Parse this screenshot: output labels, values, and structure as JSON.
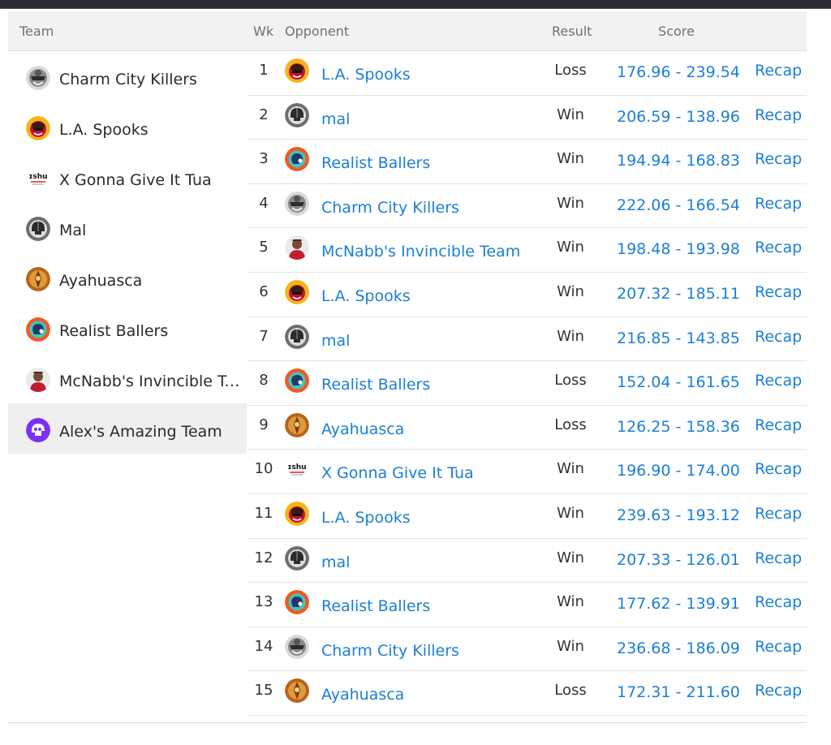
{
  "header": {
    "team": "Team",
    "wk": "Wk",
    "opponent": "Opponent",
    "result": "Result",
    "score": "Score"
  },
  "colors": {
    "link": "#1a7fd6",
    "header_bg": "#f2f2f2",
    "active_bg": "#efefef"
  },
  "teams": [
    {
      "name": "Charm City Killers",
      "icon": "charm-city-killers-logo-icon"
    },
    {
      "name": "L.A. Spooks",
      "icon": "la-spooks-logo-icon"
    },
    {
      "name": "X Gonna Give It Tua",
      "icon": "x-gonna-give-it-tua-logo-icon"
    },
    {
      "name": "Mal",
      "icon": "mal-logo-icon"
    },
    {
      "name": "Ayahuasca",
      "icon": "ayahuasca-logo-icon"
    },
    {
      "name": "Realist Ballers",
      "icon": "realist-ballers-logo-icon"
    },
    {
      "name": "McNabb's Invincible Team",
      "icon": "mcnabbs-invincible-team-logo-icon"
    },
    {
      "name": "Alex's Amazing Team",
      "icon": "alexs-amazing-team-logo-icon",
      "active": true
    }
  ],
  "schedule": [
    {
      "wk": "1",
      "opponent": "L.A. Spooks",
      "logo": "spooks",
      "result": "Loss",
      "score": "176.96 - 239.54",
      "recap": "Recap"
    },
    {
      "wk": "2",
      "opponent": "mal",
      "logo": "mal",
      "result": "Win",
      "score": "206.59 - 138.96",
      "recap": "Recap"
    },
    {
      "wk": "3",
      "opponent": "Realist Ballers",
      "logo": "realist",
      "result": "Win",
      "score": "194.94 - 168.83",
      "recap": "Recap"
    },
    {
      "wk": "4",
      "opponent": "Charm City Killers",
      "logo": "charm",
      "result": "Win",
      "score": "222.06 - 166.54",
      "recap": "Recap"
    },
    {
      "wk": "5",
      "opponent": "McNabb's Invincible Team",
      "logo": "mcnabb",
      "result": "Win",
      "score": "198.48 - 193.98",
      "recap": "Recap"
    },
    {
      "wk": "6",
      "opponent": "L.A. Spooks",
      "logo": "spooks",
      "result": "Win",
      "score": "207.32 - 185.11",
      "recap": "Recap"
    },
    {
      "wk": "7",
      "opponent": "mal",
      "logo": "mal",
      "result": "Win",
      "score": "216.85 - 143.85",
      "recap": "Recap"
    },
    {
      "wk": "8",
      "opponent": "Realist Ballers",
      "logo": "realist",
      "result": "Loss",
      "score": "152.04 - 161.65",
      "recap": "Recap"
    },
    {
      "wk": "9",
      "opponent": "Ayahuasca",
      "logo": "ayahuasca",
      "result": "Loss",
      "score": "126.25 - 158.36",
      "recap": "Recap"
    },
    {
      "wk": "10",
      "opponent": "X Gonna Give It Tua",
      "logo": "tua",
      "result": "Win",
      "score": "196.90 - 174.00",
      "recap": "Recap"
    },
    {
      "wk": "11",
      "opponent": "L.A. Spooks",
      "logo": "spooks",
      "result": "Win",
      "score": "239.63 - 193.12",
      "recap": "Recap"
    },
    {
      "wk": "12",
      "opponent": "mal",
      "logo": "mal",
      "result": "Win",
      "score": "207.33 - 126.01",
      "recap": "Recap"
    },
    {
      "wk": "13",
      "opponent": "Realist Ballers",
      "logo": "realist",
      "result": "Win",
      "score": "177.62 - 139.91",
      "recap": "Recap"
    },
    {
      "wk": "14",
      "opponent": "Charm City Killers",
      "logo": "charm",
      "result": "Win",
      "score": "236.68 - 186.09",
      "recap": "Recap"
    },
    {
      "wk": "15",
      "opponent": "Ayahuasca",
      "logo": "ayahuasca",
      "result": "Loss",
      "score": "172.31 - 211.60",
      "recap": "Recap"
    }
  ]
}
